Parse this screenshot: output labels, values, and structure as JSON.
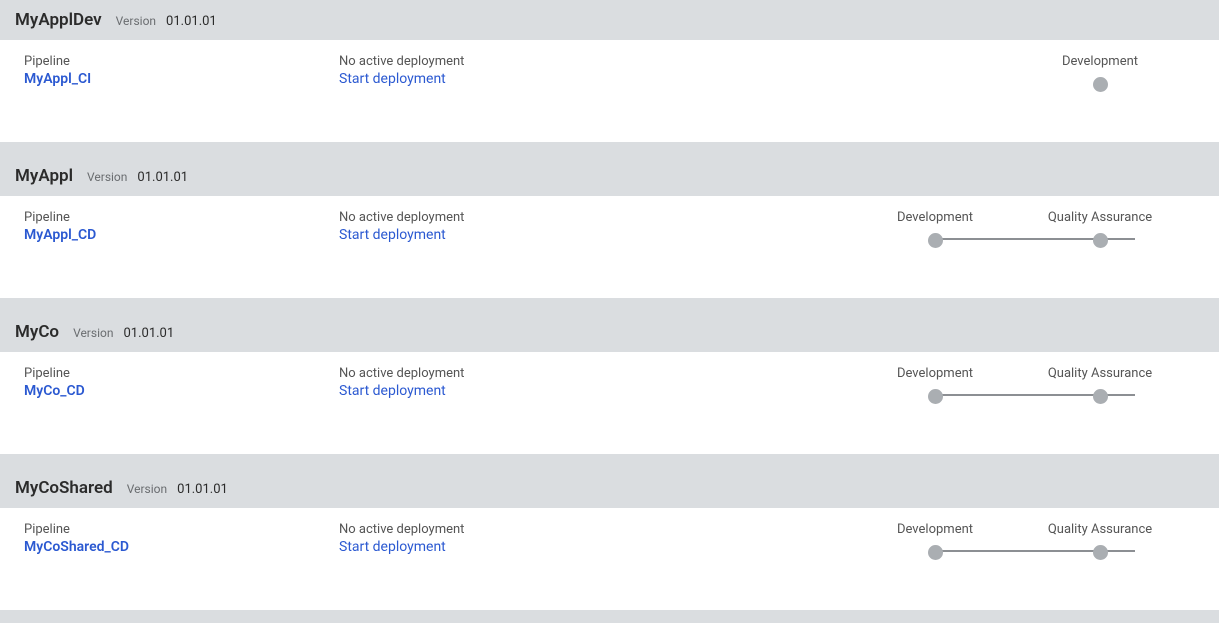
{
  "labels": {
    "version": "Version",
    "pipeline": "Pipeline",
    "no_active_deployment": "No active deployment",
    "start_deployment": "Start deployment"
  },
  "applications": [
    {
      "name": "MyApplDev",
      "version": "01.01.01",
      "pipeline_name": "MyAppl_CI",
      "stages": [
        {
          "label": "Development"
        }
      ]
    },
    {
      "name": "MyAppl",
      "version": "01.01.01",
      "pipeline_name": "MyAppl_CD",
      "stages": [
        {
          "label": "Development"
        },
        {
          "label": "Quality Assurance"
        }
      ]
    },
    {
      "name": "MyCo",
      "version": "01.01.01",
      "pipeline_name": "MyCo_CD",
      "stages": [
        {
          "label": "Development"
        },
        {
          "label": "Quality Assurance"
        }
      ]
    },
    {
      "name": "MyCoShared",
      "version": "01.01.01",
      "pipeline_name": "MyCoShared_CD",
      "stages": [
        {
          "label": "Development"
        },
        {
          "label": "Quality Assurance"
        }
      ]
    }
  ]
}
